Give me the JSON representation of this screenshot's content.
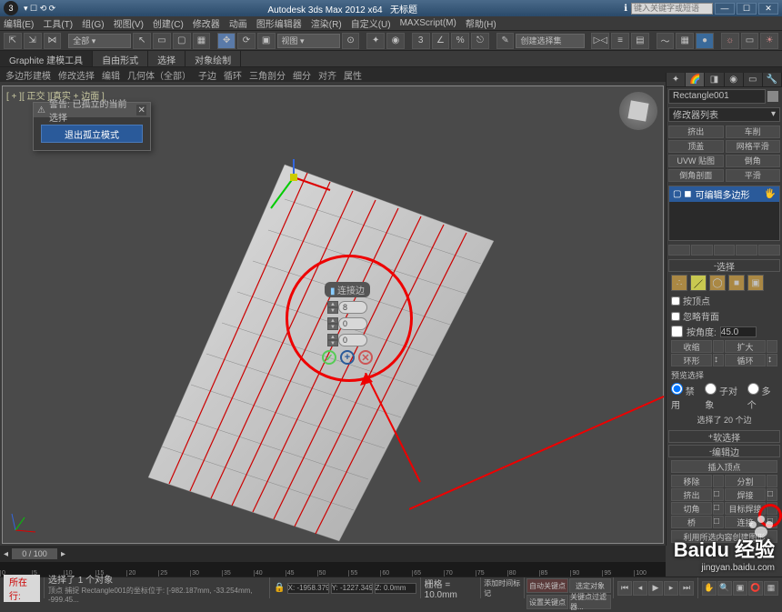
{
  "titlebar": {
    "app": "Autodesk 3ds Max 2012 x64",
    "doc": "无标题",
    "search_placeholder": "键入关键字或短语"
  },
  "menu": [
    "编辑(E)",
    "工具(T)",
    "组(G)",
    "视图(V)",
    "创建(C)",
    "修改器",
    "动画",
    "图形编辑器",
    "渲染(R)",
    "自定义(U)",
    "MAXScript(M)",
    "帮助(H)"
  ],
  "selection_set": "创建选择集",
  "ribbon_tabs": [
    "Graphite 建模工具",
    "自由形式",
    "选择",
    "对象绘制"
  ],
  "sub_ribbon": [
    "多边形建模",
    "修改选择",
    "编辑",
    "几何体（全部）",
    "子边",
    "循环",
    "三角剖分",
    "细分",
    "对齐",
    "属性"
  ],
  "viewport_label": "[ + ][ 正交 ][真实 + 边面 ]",
  "warning": {
    "title": "警告: 已孤立的当前选择",
    "button": "退出孤立模式"
  },
  "caddy": {
    "title": "连接边",
    "seg": "8",
    "pinch": "0",
    "slide": "0"
  },
  "panel": {
    "object_name": "Rectangle001",
    "modlist_label": "修改器列表",
    "btn_grid": [
      [
        "挤出",
        "车削"
      ],
      [
        "顶盖",
        "网格平滑"
      ],
      [
        "UVW 贴图",
        "倒角"
      ],
      [
        "倒角剖面",
        "平滑"
      ]
    ],
    "modifier": "可编辑多边形",
    "roll_selection": "选择",
    "chk1": "按顶点",
    "chk2": "忽略背面",
    "angle_lbl": "按角度:",
    "angle_val": "45.0",
    "shrink": "收缩",
    "grow": "扩大",
    "ring": "环形",
    "loop": "循环",
    "preview_lbl": "预览选择",
    "prev_off": "禁用",
    "prev_sub": "子对象",
    "prev_multi": "多个",
    "sel_summary": "选择了 20 个边",
    "roll_soft": "软选择",
    "roll_edit": "编辑边",
    "insert_v": "插入顶点",
    "r1a": "移除",
    "r1b": "分割",
    "r2a": "挤出",
    "r2b": "焊接",
    "r3a": "切角",
    "r3b": "目标焊接",
    "r4a": "桥",
    "r4b": "连接",
    "long_btn": "利用所选内容创建图形"
  },
  "timeslider": "0 / 100",
  "status": {
    "active": "所在行:",
    "sel": "选择了 1 个对象",
    "prompt": "顶点 捕捉 Rectangle001的坐标位于: [-982.187mm, -33.254mm, -999.45...",
    "x": "X: -1958.379m",
    "y": "Y: -1227.349m",
    "z": "Z: 0.0mm",
    "grid": "栅格 = 10.0mm",
    "autokey": "自动关键点",
    "selset2": "选定对象",
    "setkey": "设置关键点",
    "keyfilter": "关键点过滤器...",
    "addtime": "添加时间标记"
  },
  "watermark": {
    "main": "Baidu 经验",
    "sub": "jingyan.baidu.com"
  },
  "icons": {
    "min": "—",
    "max": "☐",
    "close": "✕"
  }
}
